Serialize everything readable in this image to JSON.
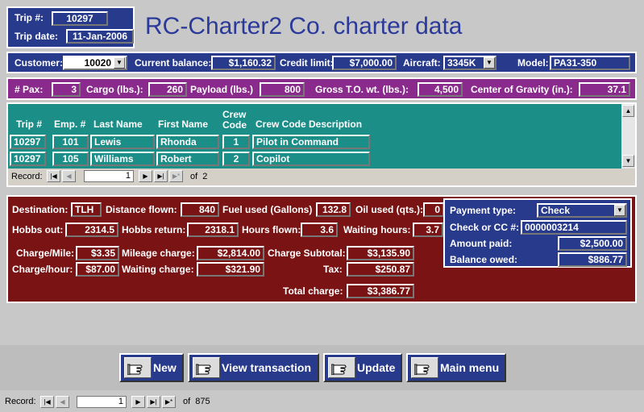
{
  "header": {
    "trip_label": "Trip #:",
    "trip": "10297",
    "date_label": "Trip date:",
    "date": "11-Jan-2006"
  },
  "title": "RC-Charter2 Co. charter data",
  "customer_band": {
    "customer_label": "Customer:",
    "customer": "10020",
    "balance_label": "Current balance:",
    "balance": "$1,160.32",
    "credit_label": "Credit limit:",
    "credit": "$7,000.00",
    "aircraft_label": "Aircraft:",
    "aircraft": "3345K",
    "model_label": "Model:",
    "model": "PA31-350"
  },
  "pax_band": {
    "pax_label": "# Pax:",
    "pax": "3",
    "cargo_label": "Cargo (lbs.):",
    "cargo": "260",
    "payload_label": "Payload (lbs.)",
    "payload": "800",
    "gross_label": "Gross T.O. wt. (lbs.):",
    "gross": "4,500",
    "cog_label": "Center of Gravity (in.):",
    "cog": "37.1"
  },
  "crew": {
    "headers": {
      "trip": "Trip #",
      "emp": "Emp. #",
      "last": "Last Name",
      "first": "First Name",
      "code1": "Crew",
      "code2": "Code",
      "desc": "Crew Code Description"
    },
    "rows": [
      {
        "trip": "10297",
        "emp": "101",
        "last": "Lewis",
        "first": "Rhonda",
        "code": "1",
        "desc": "Pilot in Command"
      },
      {
        "trip": "10297",
        "emp": "105",
        "last": "Williams",
        "first": "Robert",
        "code": "2",
        "desc": "Copilot"
      }
    ],
    "nav": {
      "record_label": "Record:",
      "current": "1",
      "of_label": "of  2"
    }
  },
  "charges": {
    "dest_label": "Destination:",
    "dest": "TLH",
    "dist_label": "Distance flown:",
    "dist": "840",
    "fuel_label": "Fuel used (Gallons)",
    "fuel": "132.8",
    "oil_label": "Oil used (qts.):",
    "oil": "0",
    "hobbs_out_label": "Hobbs out:",
    "hobbs_out": "2314.5",
    "hobbs_ret_label": "Hobbs return:",
    "hobbs_ret": "2318.1",
    "hours_label": "Hours flown:",
    "hours": "3.6",
    "wait_label": "Waiting hours:",
    "wait": "3.7",
    "cpm_label": "Charge/Mile:",
    "cpm": "$3.35",
    "mileage_label": "Mileage charge:",
    "mileage": "$2,814.00",
    "subtotal_label": "Charge Subtotal:",
    "subtotal": "$3,135.90",
    "cph_label": "Charge/hour:",
    "cph": "$87.00",
    "waitchg_label": "Waiting charge:",
    "waitchg": "$321.90",
    "tax_label": "Tax:",
    "tax": "$250.87",
    "total_label": "Total charge:",
    "total": "$3,386.77"
  },
  "payment": {
    "type_label": "Payment type:",
    "type": "Check",
    "check_label": "Check or CC #:",
    "check": "0000003214",
    "paid_label": "Amount paid:",
    "paid": "$2,500.00",
    "owed_label": "Balance owed:",
    "owed": "$886.77"
  },
  "buttons": {
    "new": "New",
    "view": "View transaction",
    "update": "Update",
    "main": "Main menu"
  },
  "main_nav": {
    "record_label": "Record:",
    "current": "1",
    "of_label": "of  875"
  },
  "colors": {
    "header_blue": "#283a8c",
    "pax_purple": "#8a2a8c",
    "crew_teal": "#1c8e88",
    "charge_red": "#7a1414",
    "title_blue": "#2b3a9a"
  }
}
